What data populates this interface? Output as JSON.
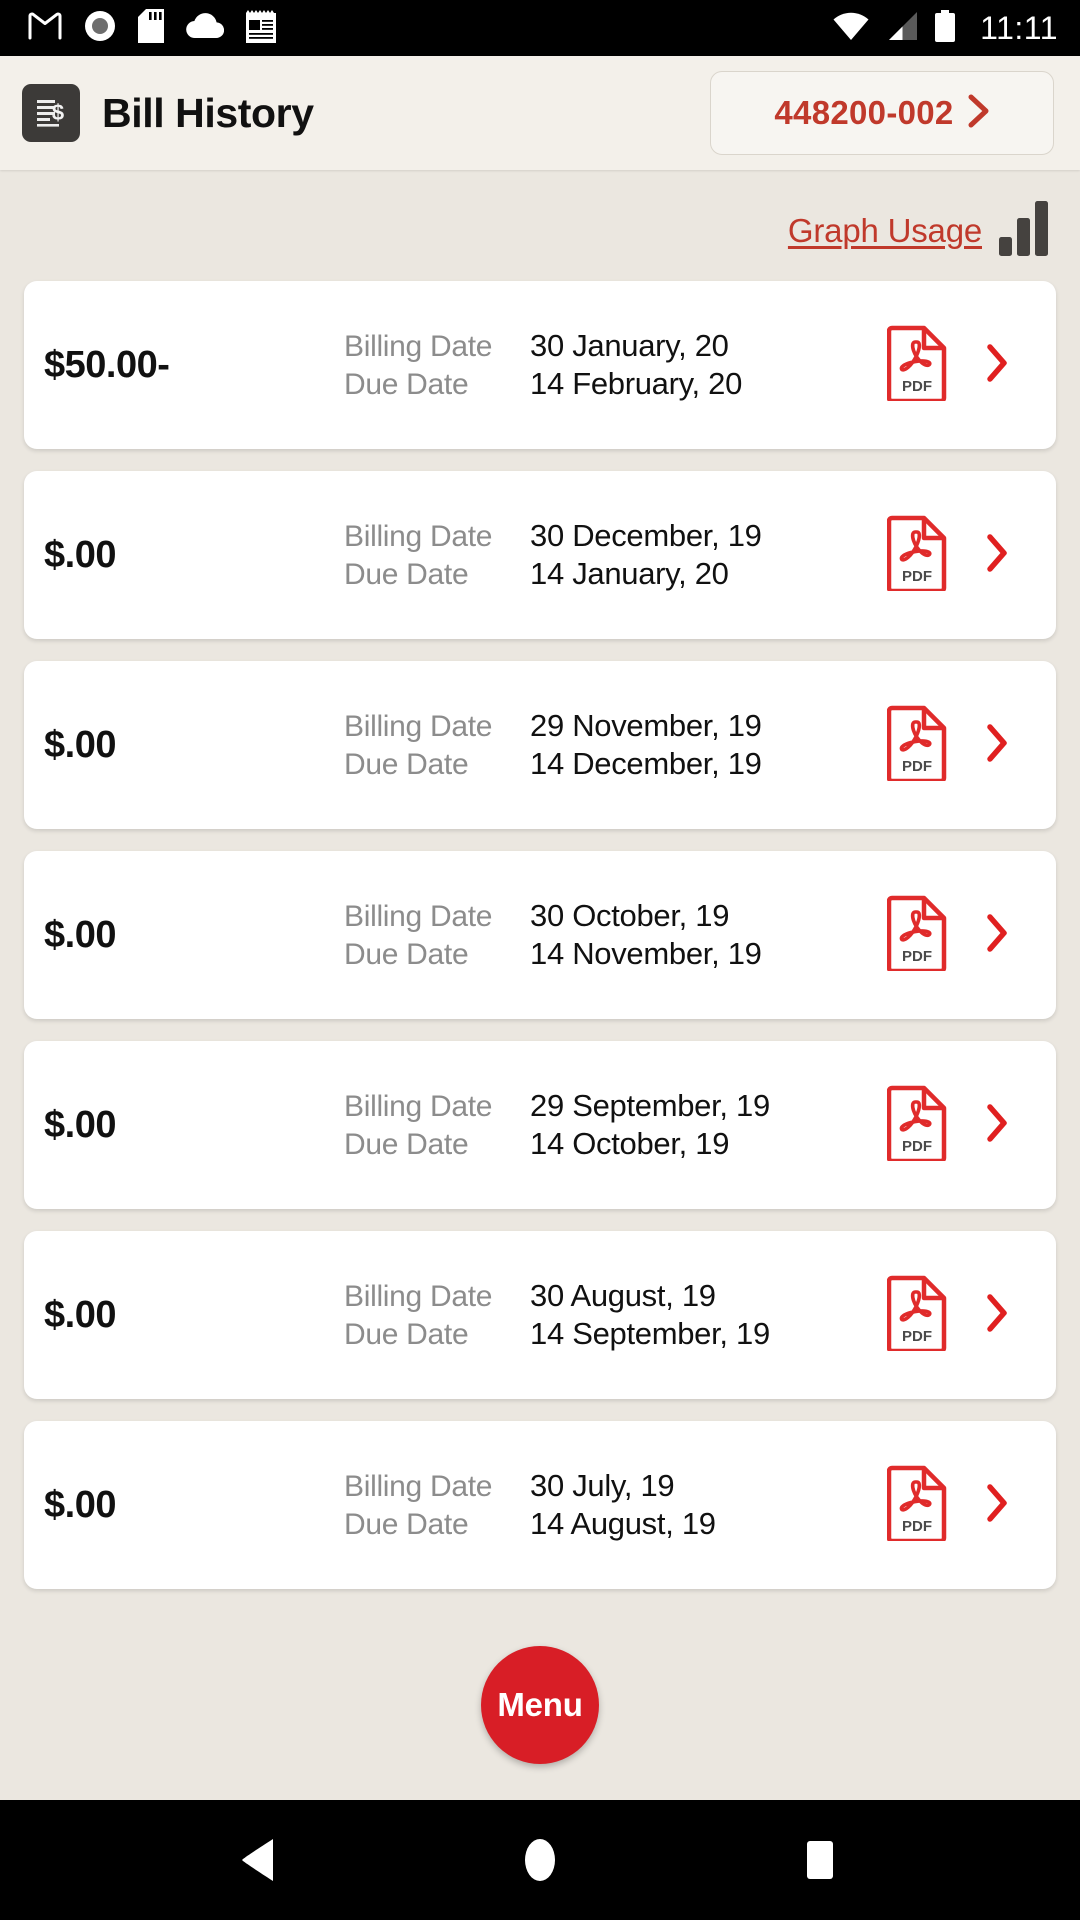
{
  "status_bar": {
    "time": "11:11",
    "left_icons": [
      "gmail-icon",
      "record-icon",
      "sd-card-icon",
      "cloud-icon",
      "news-icon"
    ],
    "right_icons": [
      "wifi-icon",
      "cell-signal-icon",
      "battery-icon"
    ],
    "background_color": "#000000",
    "foreground_color": "#FFFFFF"
  },
  "header": {
    "icon_name": "bill-document-icon",
    "title": "Bill History",
    "account": {
      "number": "448200-002",
      "chevron_icon": "chevron-right-icon",
      "accent_color": "#C0392B"
    },
    "background_color": "#F3F0EA"
  },
  "toolbar": {
    "graph_usage_label": "Graph Usage",
    "graph_usage_icon": "bar-chart-icon",
    "link_color": "#C0392B"
  },
  "bills": {
    "labels": {
      "billing_date": "Billing Date",
      "due_date": "Due Date"
    },
    "pdf_icon_label": "PDF",
    "items": [
      {
        "amount": "$50.00-",
        "billing_date": "30 January, 20",
        "due_date": "14 February, 20"
      },
      {
        "amount": "$.00",
        "billing_date": "30 December, 19",
        "due_date": "14 January, 20"
      },
      {
        "amount": "$.00",
        "billing_date": "29 November, 19",
        "due_date": "14 December, 19"
      },
      {
        "amount": "$.00",
        "billing_date": "30 October, 19",
        "due_date": "14 November, 19"
      },
      {
        "amount": "$.00",
        "billing_date": "29 September, 19",
        "due_date": "14 October, 19"
      },
      {
        "amount": "$.00",
        "billing_date": "30 August, 19",
        "due_date": "14 September, 19"
      },
      {
        "amount": "$.00",
        "billing_date": "30 July, 19",
        "due_date": "14 August, 19"
      }
    ]
  },
  "fab": {
    "label": "Menu",
    "color": "#D81E26"
  },
  "nav_bar": {
    "back_icon": "back-triangle-icon",
    "home_icon": "home-circle-icon",
    "recents_icon": "recents-square-icon",
    "background_color": "#000000"
  },
  "theme": {
    "page_background": "#EBE7E0",
    "card_background": "#FFFFFF",
    "accent_red": "#C0392B",
    "muted_text": "#8C8C8C"
  }
}
